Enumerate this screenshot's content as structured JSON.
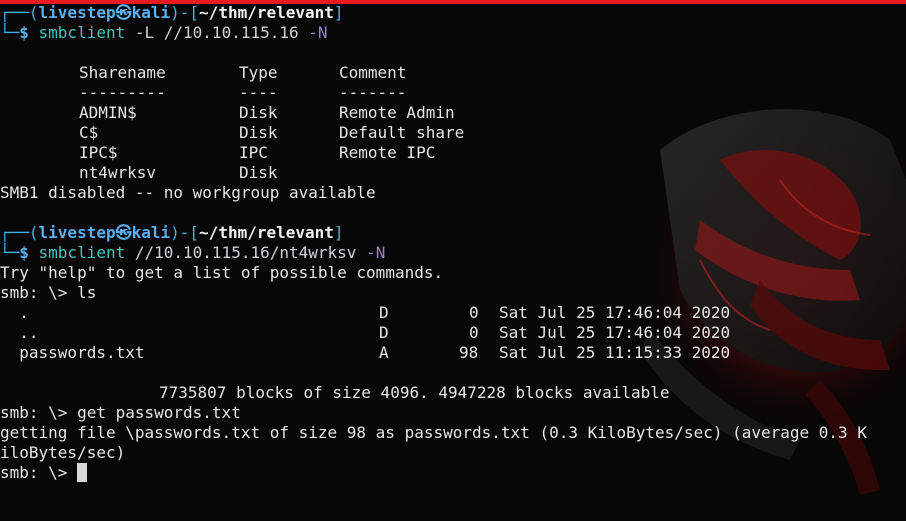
{
  "terminal": {
    "prompt1": {
      "corner": "┌──(",
      "user": "livestep",
      "skull": "㉿",
      "host": "kali",
      "mid": ")-[",
      "path": "~/thm/relevant",
      "end": "]",
      "bottom": "└─",
      "dollar": "$ ",
      "cmd": "smbclient",
      "arg": " -L //10.10.115.16",
      "flag": " -N"
    },
    "share_table": {
      "headers": [
        "Sharename",
        "Type",
        "Comment"
      ],
      "dashes": [
        "---------",
        "----",
        "-------"
      ],
      "rows": [
        [
          "ADMIN$",
          "Disk",
          "Remote Admin"
        ],
        [
          "C$",
          "Disk",
          "Default share"
        ],
        [
          "IPC$",
          "IPC",
          "Remote IPC"
        ],
        [
          "nt4wrksv",
          "Disk",
          ""
        ]
      ]
    },
    "smb1_note": "SMB1 disabled -- no workgroup available",
    "prompt2": {
      "corner": "┌──(",
      "user": "livestep",
      "skull": "㉿",
      "host": "kali",
      "mid": ")-[",
      "path": "~/thm/relevant",
      "end": "]",
      "bottom": "└─",
      "dollar": "$ ",
      "cmd": "smbclient",
      "arg": " //10.10.115.16/nt4wrksv",
      "flag": " -N"
    },
    "help_line": "Try \"help\" to get a list of possible commands.",
    "smb_ls": "smb: \\> ls",
    "listing": [
      [
        "  .",
        "D",
        "0",
        "Sat Jul 25 17:46:04 2020"
      ],
      [
        "  ..",
        "D",
        "0",
        "Sat Jul 25 17:46:04 2020"
      ],
      [
        "  passwords.txt",
        "A",
        "98",
        "Sat Jul 25 11:15:33 2020"
      ]
    ],
    "blocks_line": "7735807 blocks of size 4096. 4947228 blocks available",
    "smb_get": "smb: \\> get passwords.txt",
    "getting_1": "getting file \\passwords.txt of size 98 as passwords.txt (0.3 KiloBytes/sec) (average 0.3 K",
    "getting_2": "iloBytes/sec)",
    "smb_final": "smb: \\> "
  },
  "colors": {
    "accent_bar": "#e8191f",
    "background": "#070707",
    "prompt_blue": "#5ab0f0",
    "command_cyan": "#43c6c1"
  }
}
